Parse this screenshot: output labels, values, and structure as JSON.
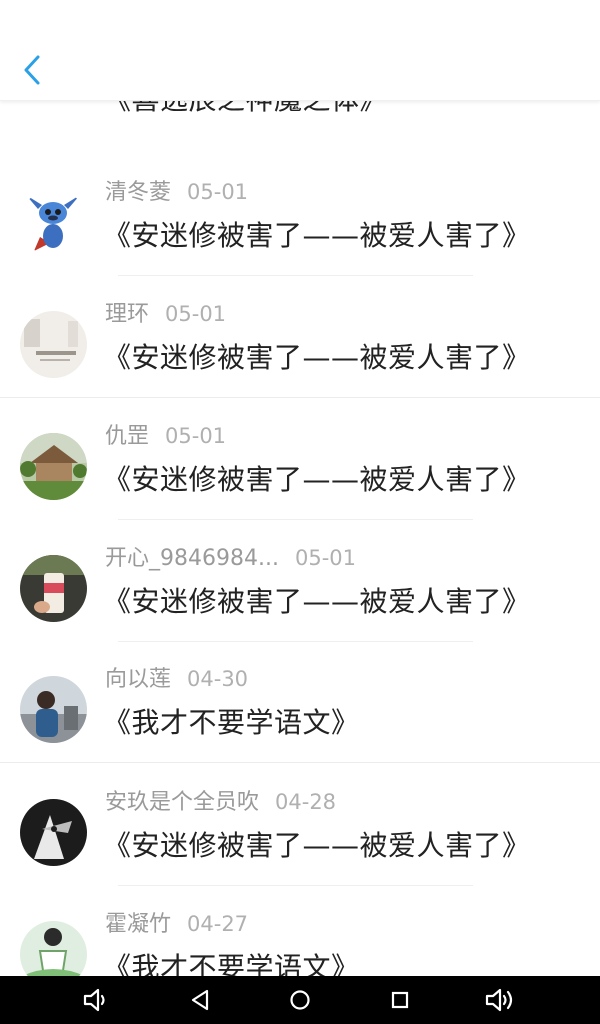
{
  "header": {
    "back_icon": "chevron-left-icon",
    "accent_color": "#2aa0e6"
  },
  "list": {
    "partial_top_title": "《喜逃辰之神魔之体》",
    "items": [
      {
        "name": "清冬菱",
        "date": "05-01",
        "title": "《安迷修被害了——被爱人害了》",
        "avatar": "stitch-cartoon"
      },
      {
        "name": "理环",
        "date": "05-01",
        "title": "《安迷修被害了——被爱人害了》",
        "avatar": "light-photo"
      },
      {
        "name": "仇罡",
        "date": "05-01",
        "title": "《安迷修被害了——被爱人害了》",
        "avatar": "house-scenery"
      },
      {
        "name": "开心_9846984...",
        "date": "05-01",
        "title": "《安迷修被害了——被爱人害了》",
        "avatar": "drink-can"
      },
      {
        "name": "向以莲",
        "date": "04-30",
        "title": "《我才不要学语文》",
        "avatar": "person-outdoor"
      },
      {
        "name": "安玖是个全员吹",
        "date": "04-28",
        "title": "《安迷修被害了——被爱人害了》",
        "avatar": "anime-dark"
      },
      {
        "name": "霍凝竹",
        "date": "04-27",
        "title": "《我才不要学语文》",
        "avatar": "anime-green"
      }
    ]
  },
  "navbar": {
    "buttons": [
      "volume-down-icon",
      "back-triangle-icon",
      "home-circle-icon",
      "recents-square-icon",
      "volume-up-icon"
    ]
  }
}
